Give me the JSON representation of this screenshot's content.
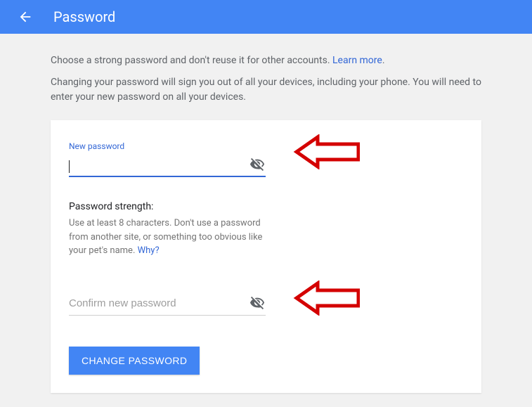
{
  "header": {
    "title": "Password"
  },
  "intro": {
    "line1_part1": "Choose a strong password and don't reuse it for other accounts. ",
    "learn_more": "Learn more",
    "line2": "Changing your password will sign you out of all your devices, including your phone. You will need to enter your new password on all your devices."
  },
  "form": {
    "new_password_label": "New password",
    "new_password_value": "",
    "strength_title": "Password strength:",
    "strength_desc_part1": "Use at least 8 characters. Don't use a password from another site, or something too obvious like your pet's name. ",
    "strength_why": "Why?",
    "confirm_placeholder": "Confirm new password",
    "confirm_value": "",
    "submit_label": "CHANGE PASSWORD"
  }
}
